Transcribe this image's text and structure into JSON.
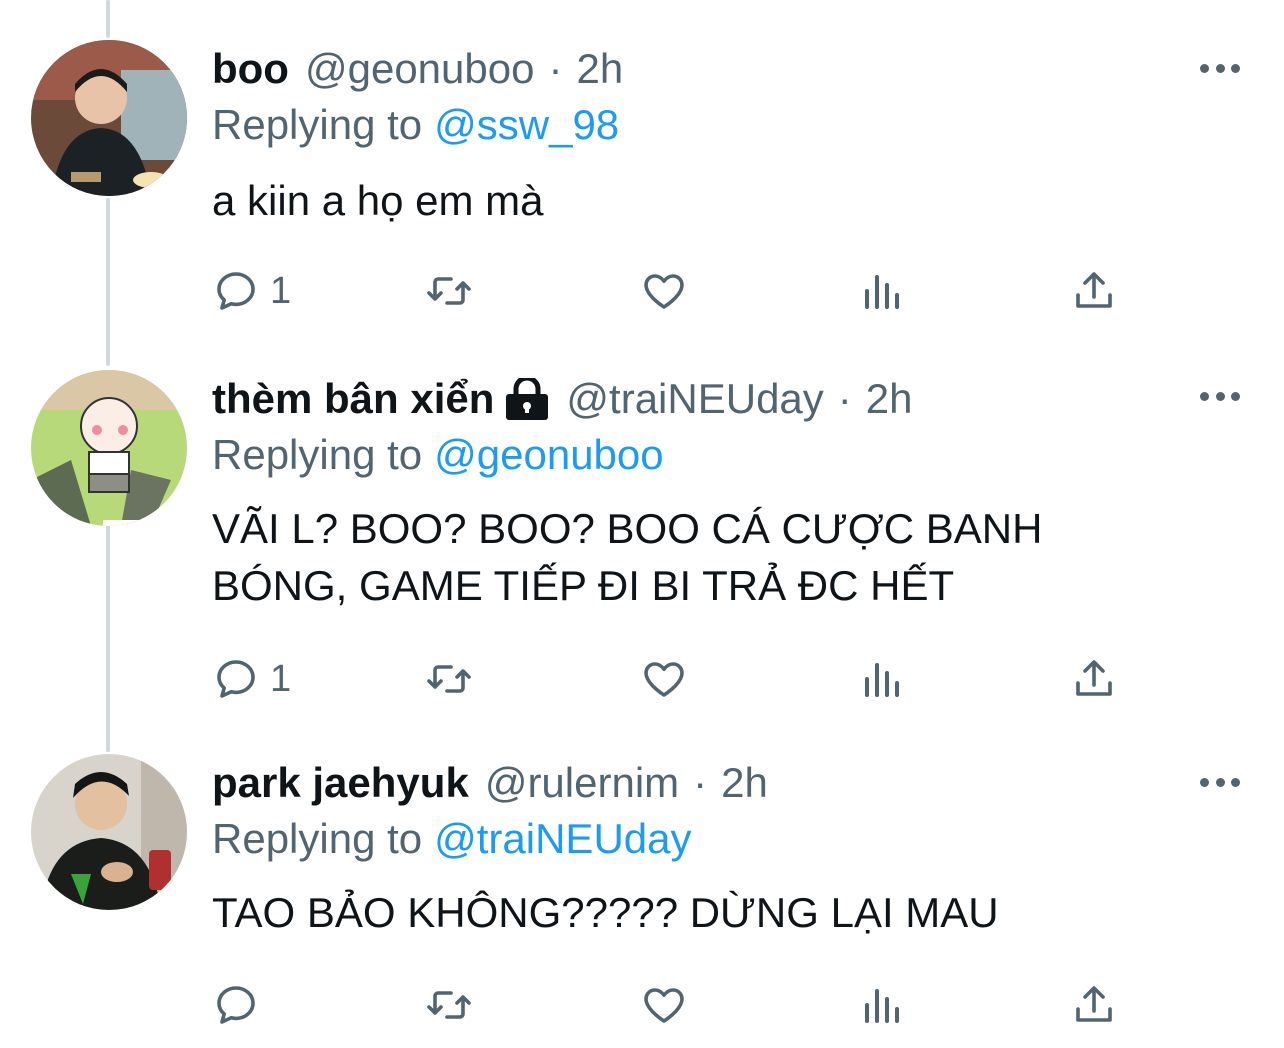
{
  "tweets": [
    {
      "name": "boo",
      "handle": "@geonuboo",
      "separator": "·",
      "time": "2h",
      "replying_label": "Replying to",
      "replying_to": "@ssw_98",
      "text_lines": [
        "a kiin a họ em mà"
      ],
      "reply_count": "1",
      "verified_lock": false
    },
    {
      "name": "thèm bân xiển",
      "handle": "@traiNEUday",
      "separator": "·",
      "time": "2h",
      "replying_label": "Replying to",
      "replying_to": "@geonuboo",
      "text_lines": [
        "VÃI L? BOO? BOO? BOO CÁ CƯỢC BANH",
        "BÓNG, GAME TIẾP ĐI BI TRẢ ĐC HẾT"
      ],
      "reply_count": "1",
      "verified_lock": true
    },
    {
      "name": "park jaehyuk",
      "handle": "@rulernim",
      "separator": "·",
      "time": "2h",
      "replying_label": "Replying to",
      "replying_to": "@traiNEUday",
      "text_lines": [
        "TAO BẢO KHÔNG????? DỪNG LẠI MAU"
      ],
      "reply_count": "",
      "verified_lock": false
    }
  ],
  "icons": {
    "reply": "reply-icon",
    "retweet": "retweet-icon",
    "like": "heart-icon",
    "analytics": "analytics-icon",
    "share": "share-icon",
    "more": "more-icon",
    "lock": "lock-icon"
  },
  "colors": {
    "text": "#0f1419",
    "secondary": "#536471",
    "accent": "#1d9bf0",
    "thread_line": "#cfd9de"
  }
}
